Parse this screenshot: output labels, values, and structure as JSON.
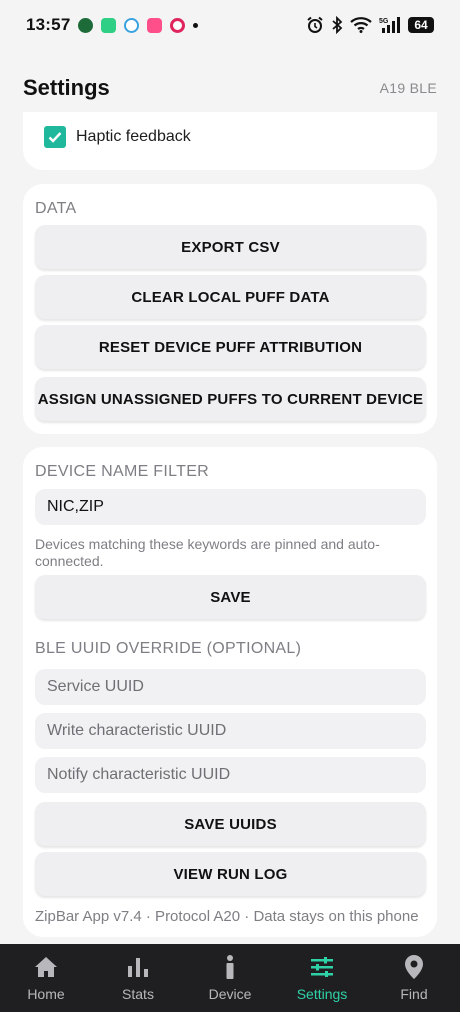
{
  "status_bar": {
    "time": "13:57",
    "battery": "64",
    "network": "5G"
  },
  "header": {
    "title": "Settings",
    "device": "A19 BLE"
  },
  "preferences": {
    "haptic_label": "Haptic feedback",
    "haptic_checked": true
  },
  "data_section": {
    "title": "DATA",
    "buttons": [
      "EXPORT CSV",
      "CLEAR LOCAL PUFF DATA",
      "RESET DEVICE PUFF ATTRIBUTION",
      "ASSIGN UNASSIGNED PUFFS TO CURRENT DEVICE"
    ]
  },
  "filter_section": {
    "title": "DEVICE NAME FILTER",
    "value": "NIC,ZIP",
    "helper": "Devices matching these keywords are pinned and auto-connected.",
    "save_label": "SAVE"
  },
  "uuid_section": {
    "title": "BLE UUID OVERRIDE (OPTIONAL)",
    "service_placeholder": "Service UUID",
    "write_placeholder": "Write characteristic UUID",
    "notify_placeholder": "Notify characteristic UUID",
    "save_label": "SAVE UUIDS",
    "log_label": "VIEW RUN LOG"
  },
  "footer": "ZipBar App v7.4 · Protocol A20 · Data stays on this phone",
  "nav": [
    {
      "label": "Home",
      "icon": "home-icon"
    },
    {
      "label": "Stats",
      "icon": "bar-chart-icon"
    },
    {
      "label": "Device",
      "icon": "info-icon"
    },
    {
      "label": "Settings",
      "icon": "sliders-icon",
      "active": true
    },
    {
      "label": "Find",
      "icon": "location-pin-icon"
    }
  ],
  "colors": {
    "accent": "#2fd2a7",
    "checkbox": "#1fb89c",
    "nav_bg": "#1f1f22"
  }
}
